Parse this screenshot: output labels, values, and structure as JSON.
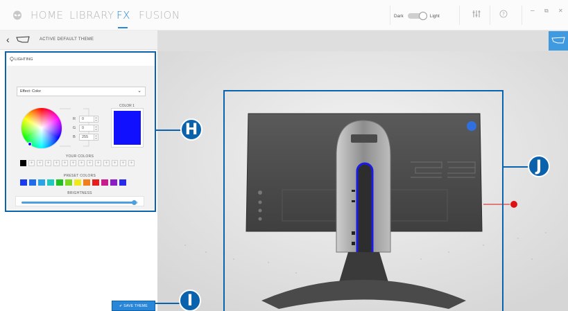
{
  "nav": {
    "items": [
      "HOME",
      "LIBRARY",
      "FX",
      "FUSION"
    ],
    "active": "FX"
  },
  "theme_toggle": {
    "left": "Dark",
    "right": "Light"
  },
  "window_controls": {
    "minimize": "–",
    "maximize": "⧉",
    "close": "✕"
  },
  "subheader": {
    "back": "‹",
    "title": "ACTIVE DEFAULT THEME"
  },
  "panel": {
    "tab": "LIGHTING",
    "effect_value": "Effect: Color",
    "rgb": [
      {
        "label": "R",
        "value": "0"
      },
      {
        "label": "G",
        "value": "0"
      },
      {
        "label": "B",
        "value": "255"
      }
    ],
    "color1_label": "COLOR 1",
    "your_colors_label": "YOUR COLORS",
    "your_colors_first": "#000000",
    "preset_colors_label": "PRESET COLORS",
    "preset_colors": [
      "#1a3cf0",
      "#1f6ee8",
      "#29a3e8",
      "#20c8c0",
      "#21c021",
      "#7fd81f",
      "#f0e81c",
      "#f07e1f",
      "#e81c1c",
      "#c81c8c",
      "#8c1cc8",
      "#2a2ae8"
    ],
    "brightness_label": "BRIGHTNESS",
    "brightness_level": 0.97,
    "save_button": "✔ SAVE THEME"
  },
  "callouts": {
    "h": "H",
    "i": "I",
    "j": "J"
  },
  "colors": {
    "accent": "#2a86d6",
    "callout": "#0a62ad",
    "selected_color": "#1010ff"
  }
}
